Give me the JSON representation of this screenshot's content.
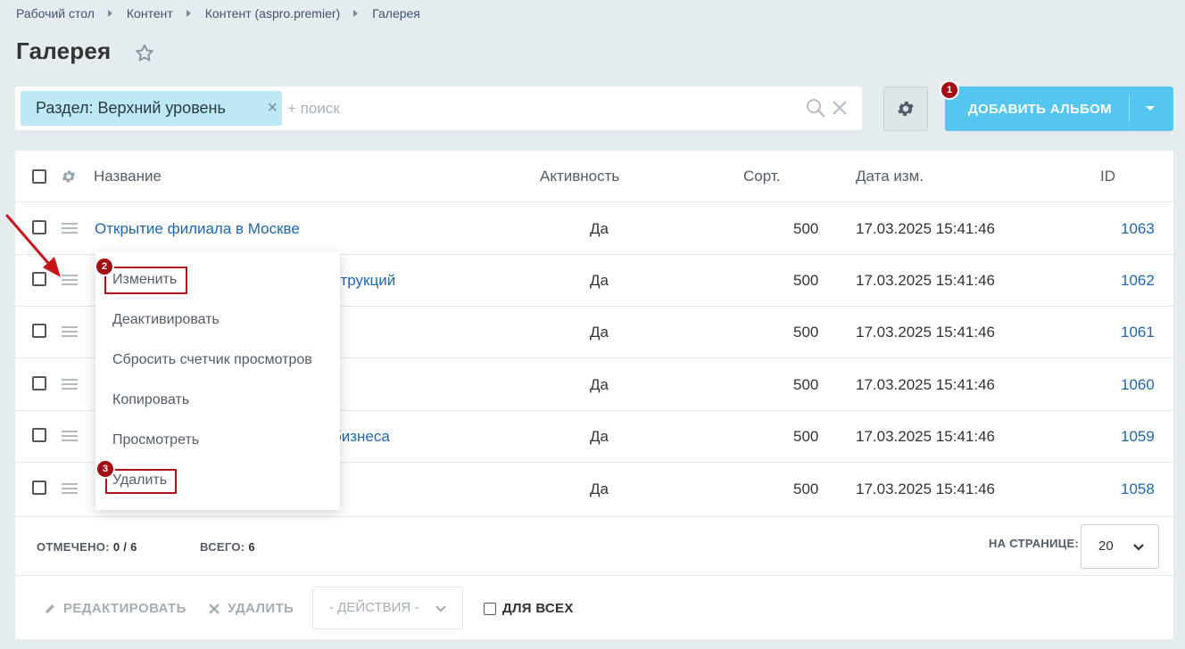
{
  "breadcrumb": [
    "Рабочий стол",
    "Контент",
    "Контент (aspro.premier)",
    "Галерея"
  ],
  "page": {
    "title": "Галерея"
  },
  "filter": {
    "chip_label": "Раздел: Верхний уровень",
    "search_placeholder": "+ поиск"
  },
  "toolbar": {
    "add_album_label": "ДОБАВИТЬ АЛЬБОМ"
  },
  "badges": {
    "first": "1",
    "second": "2",
    "third": "3"
  },
  "grid": {
    "headers": {
      "name": "Название",
      "active": "Активность",
      "sort": "Сорт.",
      "date": "Дата изм.",
      "id": "ID"
    },
    "rows": [
      {
        "name": "Открытие филиала в Москве",
        "active": "Да",
        "sort": "500",
        "date": "17.03.2025 15:41:46",
        "id": "1063"
      },
      {
        "name": "струкций",
        "active": "Да",
        "sort": "500",
        "date": "17.03.2025 15:41:46",
        "id": "1062"
      },
      {
        "name": "",
        "active": "Да",
        "sort": "500",
        "date": "17.03.2025 15:41:46",
        "id": "1061"
      },
      {
        "name": "",
        "active": "Да",
        "sort": "500",
        "date": "17.03.2025 15:41:46",
        "id": "1060"
      },
      {
        "name": "бизнеса",
        "active": "Да",
        "sort": "500",
        "date": "17.03.2025 15:41:46",
        "id": "1059"
      },
      {
        "name": "",
        "active": "Да",
        "sort": "500",
        "date": "17.03.2025 15:41:46",
        "id": "1058"
      }
    ]
  },
  "context_menu": {
    "items": [
      "Изменить",
      "Деактивировать",
      "Сбросить счетчик просмотров",
      "Копировать",
      "Просмотреть",
      "Удалить"
    ]
  },
  "footer": {
    "selected_label": "ОТМЕЧЕНО:",
    "selected_value": "0 / 6",
    "total_label": "ВСЕГО:",
    "total_value": "6",
    "per_page_label": "НА СТРАНИЦЕ:",
    "per_page_value": "20"
  },
  "actions": {
    "edit_label": "РЕДАКТИРОВАТЬ",
    "delete_label": "УДАЛИТЬ",
    "actions_select": "- ДЕЙСТВИЯ -",
    "for_all_label": "ДЛЯ ВСЕХ"
  },
  "colors": {
    "accent": "#55c6ef",
    "link": "#2067b0",
    "badge": "#a30f12",
    "highlight": "#b3121a",
    "chip": "#bde8f5"
  }
}
